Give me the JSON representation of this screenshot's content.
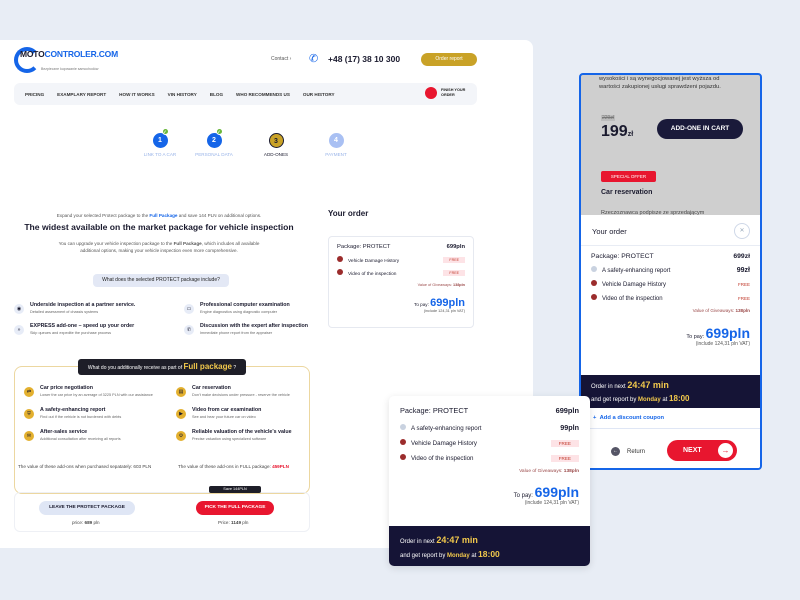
{
  "header": {
    "logo_main": "MOTO",
    "logo_accent": "CONTROLER.COM",
    "logo_tagline": "Bezpieczne kupowanie samochodów",
    "contact_label": "Contact",
    "phone": "+48 (17) 38 10 300",
    "order_button": "Order report"
  },
  "nav": {
    "items": [
      "PRICING",
      "EXAMPLARY REPORT",
      "HOW IT WORKS",
      "VIN HISTORY",
      "BLOG",
      "WHO RECOMMENDS US",
      "OUR HISTORY"
    ],
    "finish_order": "FINISH YOUR ORDER"
  },
  "steps": [
    {
      "num": "1",
      "label": "LINK TO A CAR",
      "state": "done"
    },
    {
      "num": "2",
      "label": "PERSONAL DATA",
      "state": "done"
    },
    {
      "num": "3",
      "label": "ADD-ONES",
      "state": "active"
    },
    {
      "num": "4",
      "label": "PAYMENT",
      "state": "pending"
    }
  ],
  "intro": {
    "subtitle_pre": "Expand your selected Protect package to the ",
    "subtitle_link": "Full Package",
    "subtitle_post": " and save 144 PLN on additional options.",
    "title": "The widest available on the market package for vehicle inspection",
    "desc_pre": "You can upgrade your vehicle inspection package to the ",
    "desc_bold": "Full Package",
    "desc_post": ", which includes all available additional options, making your vehicle inspection even more comprehensive.",
    "include_button": "What does the selected PROTECT package include?"
  },
  "protect_features": [
    {
      "icon": "eye-icon",
      "glyph": "◉",
      "title": "Underside inspection at a partner service.",
      "desc": "Detailed assessment of chassis systems"
    },
    {
      "icon": "laptop-icon",
      "glyph": "▭",
      "title": "Professional computer examination",
      "desc": "Engine diagnostics using diagnostic computer"
    },
    {
      "icon": "fast-forward-icon",
      "glyph": "»",
      "title": "EXPRESS add-one – speed up your order",
      "desc": "Skip queues and expedite the purchase process"
    },
    {
      "icon": "phone-icon",
      "glyph": "✆",
      "title": "Discussion with the expert after inspection",
      "desc": "Immediate phone report from the appraiser"
    }
  ],
  "full_package": {
    "label_pre": "What do you additionally receive as part of ",
    "label_bold": "Full package",
    "label_post": " ?",
    "features": [
      {
        "icon": "negotiation-icon",
        "glyph": "⇄",
        "title": "Car price negotiation",
        "desc": "Lower the car price by an average of 3225 PLN with our assistance"
      },
      {
        "icon": "reservation-icon",
        "glyph": "▤",
        "title": "Car reservation",
        "desc": "Don't make decisions under pressure - reserve the vehicle"
      },
      {
        "icon": "shield-icon",
        "glyph": "⛨",
        "title": "A safety-enhancing report",
        "desc": "Find out if the vehicle is not burdened with debts"
      },
      {
        "icon": "video-icon",
        "glyph": "▶",
        "title": "Video from car examination",
        "desc": "See and hear your future car on video"
      },
      {
        "icon": "chat-icon",
        "glyph": "✉",
        "title": "After-sales service",
        "desc": "Additional consultation after receiving all reports"
      },
      {
        "icon": "valuation-icon",
        "glyph": "⚙",
        "title": "Reliable valuation of the vehicle's value",
        "desc": "Precise valuation using specialized software"
      }
    ],
    "value_separate": "The value of these add-ons when purchased sepatately: 603 PLN",
    "value_full_pre": "The value of these add-ons in FULL package: ",
    "value_full": "459PLN"
  },
  "choice": {
    "save_tag": "Save 144PLN",
    "leave_button": "LEAVE THE PROTECT PACKAGE",
    "pick_button": "PICK THE FULL PACKAGE",
    "leave_price_label": "price: ",
    "leave_price": "689",
    "pick_price_label": "Price: ",
    "pick_price": "1149",
    "currency": " pln"
  },
  "order": {
    "title": "Your order",
    "package": "Package: PROTECT",
    "package_price": "699pln",
    "items": [
      {
        "name": "Vehicle Damage History",
        "price": "FREE"
      },
      {
        "name": "Video of the inspection",
        "price": "FREE"
      }
    ],
    "giveaway_label": "Value of Giveaways: ",
    "giveaway_value": "138pln",
    "to_pay_label": "To pay: ",
    "to_pay": "699pln",
    "vat": "(include 124,31 pln VAT)"
  },
  "mobile": {
    "top_text": "wysokości i są wynegocjowanej jest wyższa od wartości zakupionej usługi sprawdzeni pojazdu.",
    "old_price": "229zł",
    "price": "199",
    "price_unit": "zł",
    "cart_button": "ADD-ONE IN CART",
    "offer_badge": "SPECIAL OFFER",
    "offer_title": "Car reservation",
    "offer_desc": "Rzeczoznawca podpisze ze sprzedającym",
    "panel_title": "Your order",
    "package": "Package: PROTECT",
    "package_price": "699zł",
    "items": [
      {
        "name": "A safety-enhancing report",
        "price": "99zł",
        "checked": false
      },
      {
        "name": "Vehicle Damage History",
        "price": "FREE",
        "checked": true
      },
      {
        "name": "Video of the inspection",
        "price": "FREE",
        "checked": true
      }
    ],
    "giveaway_label": "Value of Giveaways: ",
    "giveaway_value": "138pln",
    "to_pay_label": "To pay: ",
    "to_pay": "699pln",
    "vat": "(include 124,31 pln VAT)",
    "timer_pre": "Order in next ",
    "timer": "24:47 min",
    "deadline_pre": "and get report by ",
    "deadline_day": "Monday",
    "deadline_mid": " at ",
    "deadline_time": "18:00",
    "coupon": "Add a discount coupon",
    "return": "Return",
    "next": "NEXT"
  },
  "card2": {
    "package": "Package: PROTECT",
    "package_price": "699pln",
    "items": [
      {
        "name": "A safety-enhancing report",
        "price": "99pln",
        "checked": false
      },
      {
        "name": "Vehicle Damage History",
        "price": "FREE",
        "checked": true
      },
      {
        "name": "Video of the inspection",
        "price": "FREE",
        "checked": true
      }
    ],
    "giveaway_label": "Value of Giveaways: ",
    "giveaway_value": "138pln",
    "to_pay_label": "To pay: ",
    "to_pay": "699pln",
    "vat": "(include 124,31 pln VAT)",
    "timer_pre": "Order in next ",
    "timer": "24:47 min",
    "deadline_pre": "and get report by ",
    "deadline_day": "Monday",
    "deadline_mid": " at ",
    "deadline_time": "18:00"
  },
  "colors": {
    "brand_blue": "#1565e8",
    "accent_gold": "#c9a227",
    "accent_red": "#e8162f",
    "dark_navy": "#151436"
  }
}
